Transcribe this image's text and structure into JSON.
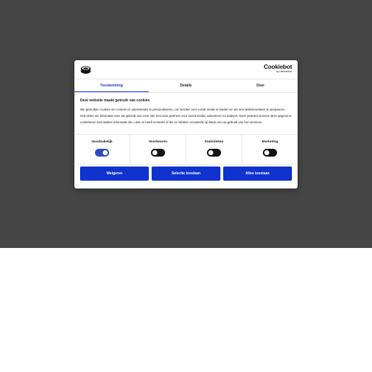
{
  "dialog": {
    "brand_name": "Cookiebot",
    "brand_sub": "by Usercentrics",
    "tabs": [
      {
        "label": "Toestemming",
        "active": true
      },
      {
        "label": "Details",
        "active": false
      },
      {
        "label": "Over",
        "active": false
      }
    ],
    "title": "Deze website maakt gebruik van cookies",
    "body": "We gebruiken cookies om content en advertenties te personaliseren, om functies voor social media te bieden en om ons websiteverkeer te analyseren. Ook delen we informatie over uw gebruik van onze site met onze partners voor social media, adverteren en analyse. Deze partners kunnen deze gegevens combineren met andere informatie die u aan ze heeft verstrekt of die ze hebben verzameld op basis van uw gebruik van hun services.",
    "toggles": [
      {
        "label": "Noodzakelijk",
        "on": true
      },
      {
        "label": "Voorkeuren",
        "on": false
      },
      {
        "label": "Statistieken",
        "on": false
      },
      {
        "label": "Marketing",
        "on": false
      }
    ],
    "buttons": {
      "deny": "Weigeren",
      "allow_selection": "Selectie toestaan",
      "allow_all": "Alles toestaan"
    }
  },
  "colors": {
    "overlay": "#454545",
    "accent": "#1032cf",
    "toggle_on": "#2d4cc0",
    "toggle_off": "#141414"
  }
}
